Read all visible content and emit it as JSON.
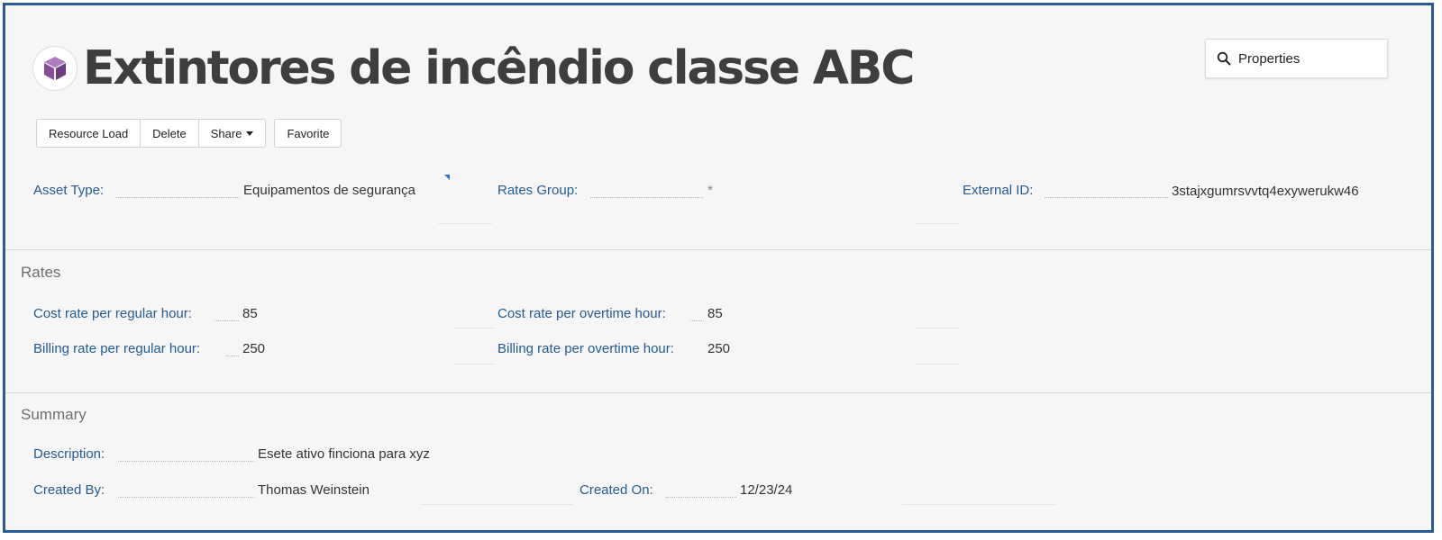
{
  "header": {
    "title": "Extintores de incêndio classe ABC",
    "icon": "cube-icon",
    "icon_color": "#8a4c9a"
  },
  "search": {
    "placeholder": "Properties",
    "icon": "search-icon"
  },
  "toolbar": {
    "resource_load": "Resource Load",
    "delete": "Delete",
    "share": "Share",
    "favorite": "Favorite"
  },
  "fields": {
    "asset_type": {
      "label": "Asset Type:",
      "value": "Equipamentos de segurança"
    },
    "rates_group": {
      "label": "Rates Group:",
      "value": "*"
    },
    "external_id": {
      "label": "External ID:",
      "value": "3stajxgumrsvvtq4exywerukw46"
    }
  },
  "rates": {
    "title": "Rates",
    "cost_regular": {
      "label": "Cost rate per regular hour:",
      "value": "85"
    },
    "cost_overtime": {
      "label": "Cost rate per overtime hour:",
      "value": "85"
    },
    "billing_regular": {
      "label": "Billing rate per regular hour:",
      "value": "250"
    },
    "billing_overtime": {
      "label": "Billing rate per overtime hour:",
      "value": "250"
    }
  },
  "summary": {
    "title": "Summary",
    "description": {
      "label": "Description:",
      "value": "Esete ativo finciona para xyz"
    },
    "created_by": {
      "label": "Created By:",
      "value": "Thomas Weinstein"
    },
    "created_on": {
      "label": "Created On:",
      "value": "12/23/24"
    }
  },
  "colors": {
    "label": "#245b90",
    "border": "#2a5b97",
    "background": "#f6f6f6"
  }
}
